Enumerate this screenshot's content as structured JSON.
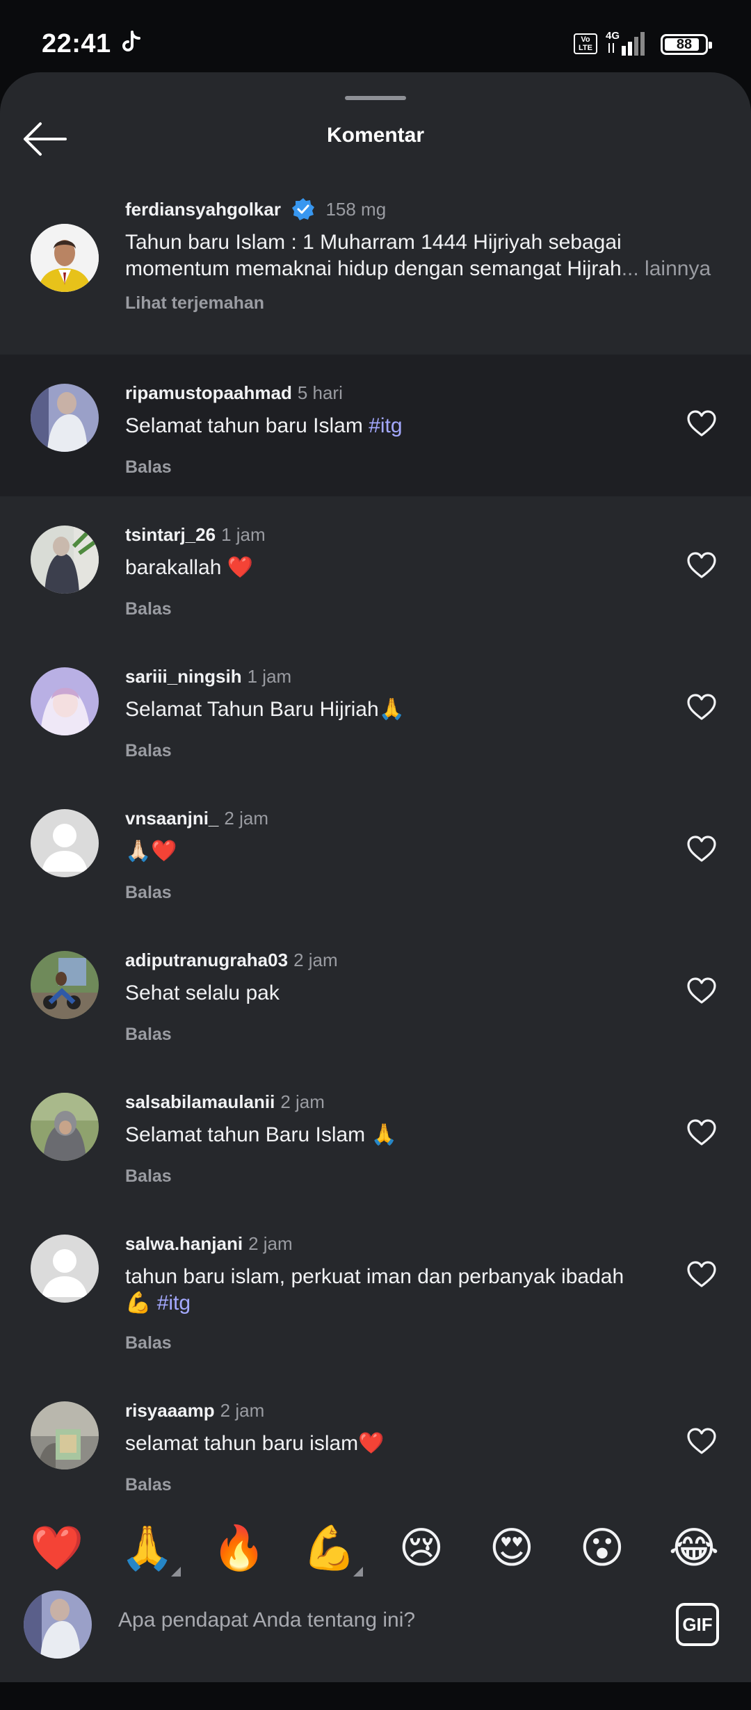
{
  "status_bar": {
    "time": "22:41",
    "network": "4G",
    "volte": "Vo LTE",
    "battery": "88",
    "battery_level": 0.88
  },
  "header": {
    "title": "Komentar"
  },
  "caption": {
    "username": "ferdiansyahgolkar",
    "time": "158 mg",
    "text_line1": "Tahun baru Islam : 1 Muharram 1444 Hijriyah sebagai",
    "text_line2": "momentum memaknai hidup dengan semangat Hijrah",
    "more": "... lainnya",
    "translate": "Lihat terjemahan"
  },
  "comments": [
    {
      "username": "ripamustopaahmad",
      "time": "5 hari",
      "text": "Selamat tahun baru Islam ",
      "hashtag": "#itg",
      "reply": "Balas"
    },
    {
      "username": "tsintarj_26",
      "time": "1 jam",
      "text": "barakallah ❤️",
      "reply": "Balas"
    },
    {
      "username": "sariii_ningsih",
      "time": "1 jam",
      "text": "Selamat Tahun Baru Hijriah🙏",
      "reply": "Balas"
    },
    {
      "username": "vnsaanjni_",
      "time": "2 jam",
      "text": "🙏🏻❤️",
      "reply": "Balas"
    },
    {
      "username": "adiputranugraha03",
      "time": "2 jam",
      "text": "Sehat selalu pak",
      "reply": "Balas"
    },
    {
      "username": "salsabilamaulanii",
      "time": "2 jam",
      "text": "Selamat tahun Baru Islam 🙏",
      "reply": "Balas"
    },
    {
      "username": "salwa.hanjani",
      "time": "2 jam",
      "text": "tahun baru islam, perkuat iman dan perbanyak ibadah",
      "text_line2": "💪 ",
      "hashtag": "#itg",
      "reply": "Balas"
    },
    {
      "username": "risyaaamp",
      "time": "2 jam",
      "text": "selamat tahun baru islam❤️",
      "reply": "Balas"
    }
  ],
  "reactions": [
    "❤️",
    "🙏",
    "🔥",
    "💪",
    "😢",
    "😍",
    "😮",
    "😂"
  ],
  "composer": {
    "placeholder": "Apa pendapat Anda tentang ini?",
    "gif_label": "GIF"
  },
  "colors": {
    "background": "#26282c",
    "highlight": "#1e1f23",
    "hashtag": "#a4a9ff",
    "verified": "#3897f0"
  }
}
